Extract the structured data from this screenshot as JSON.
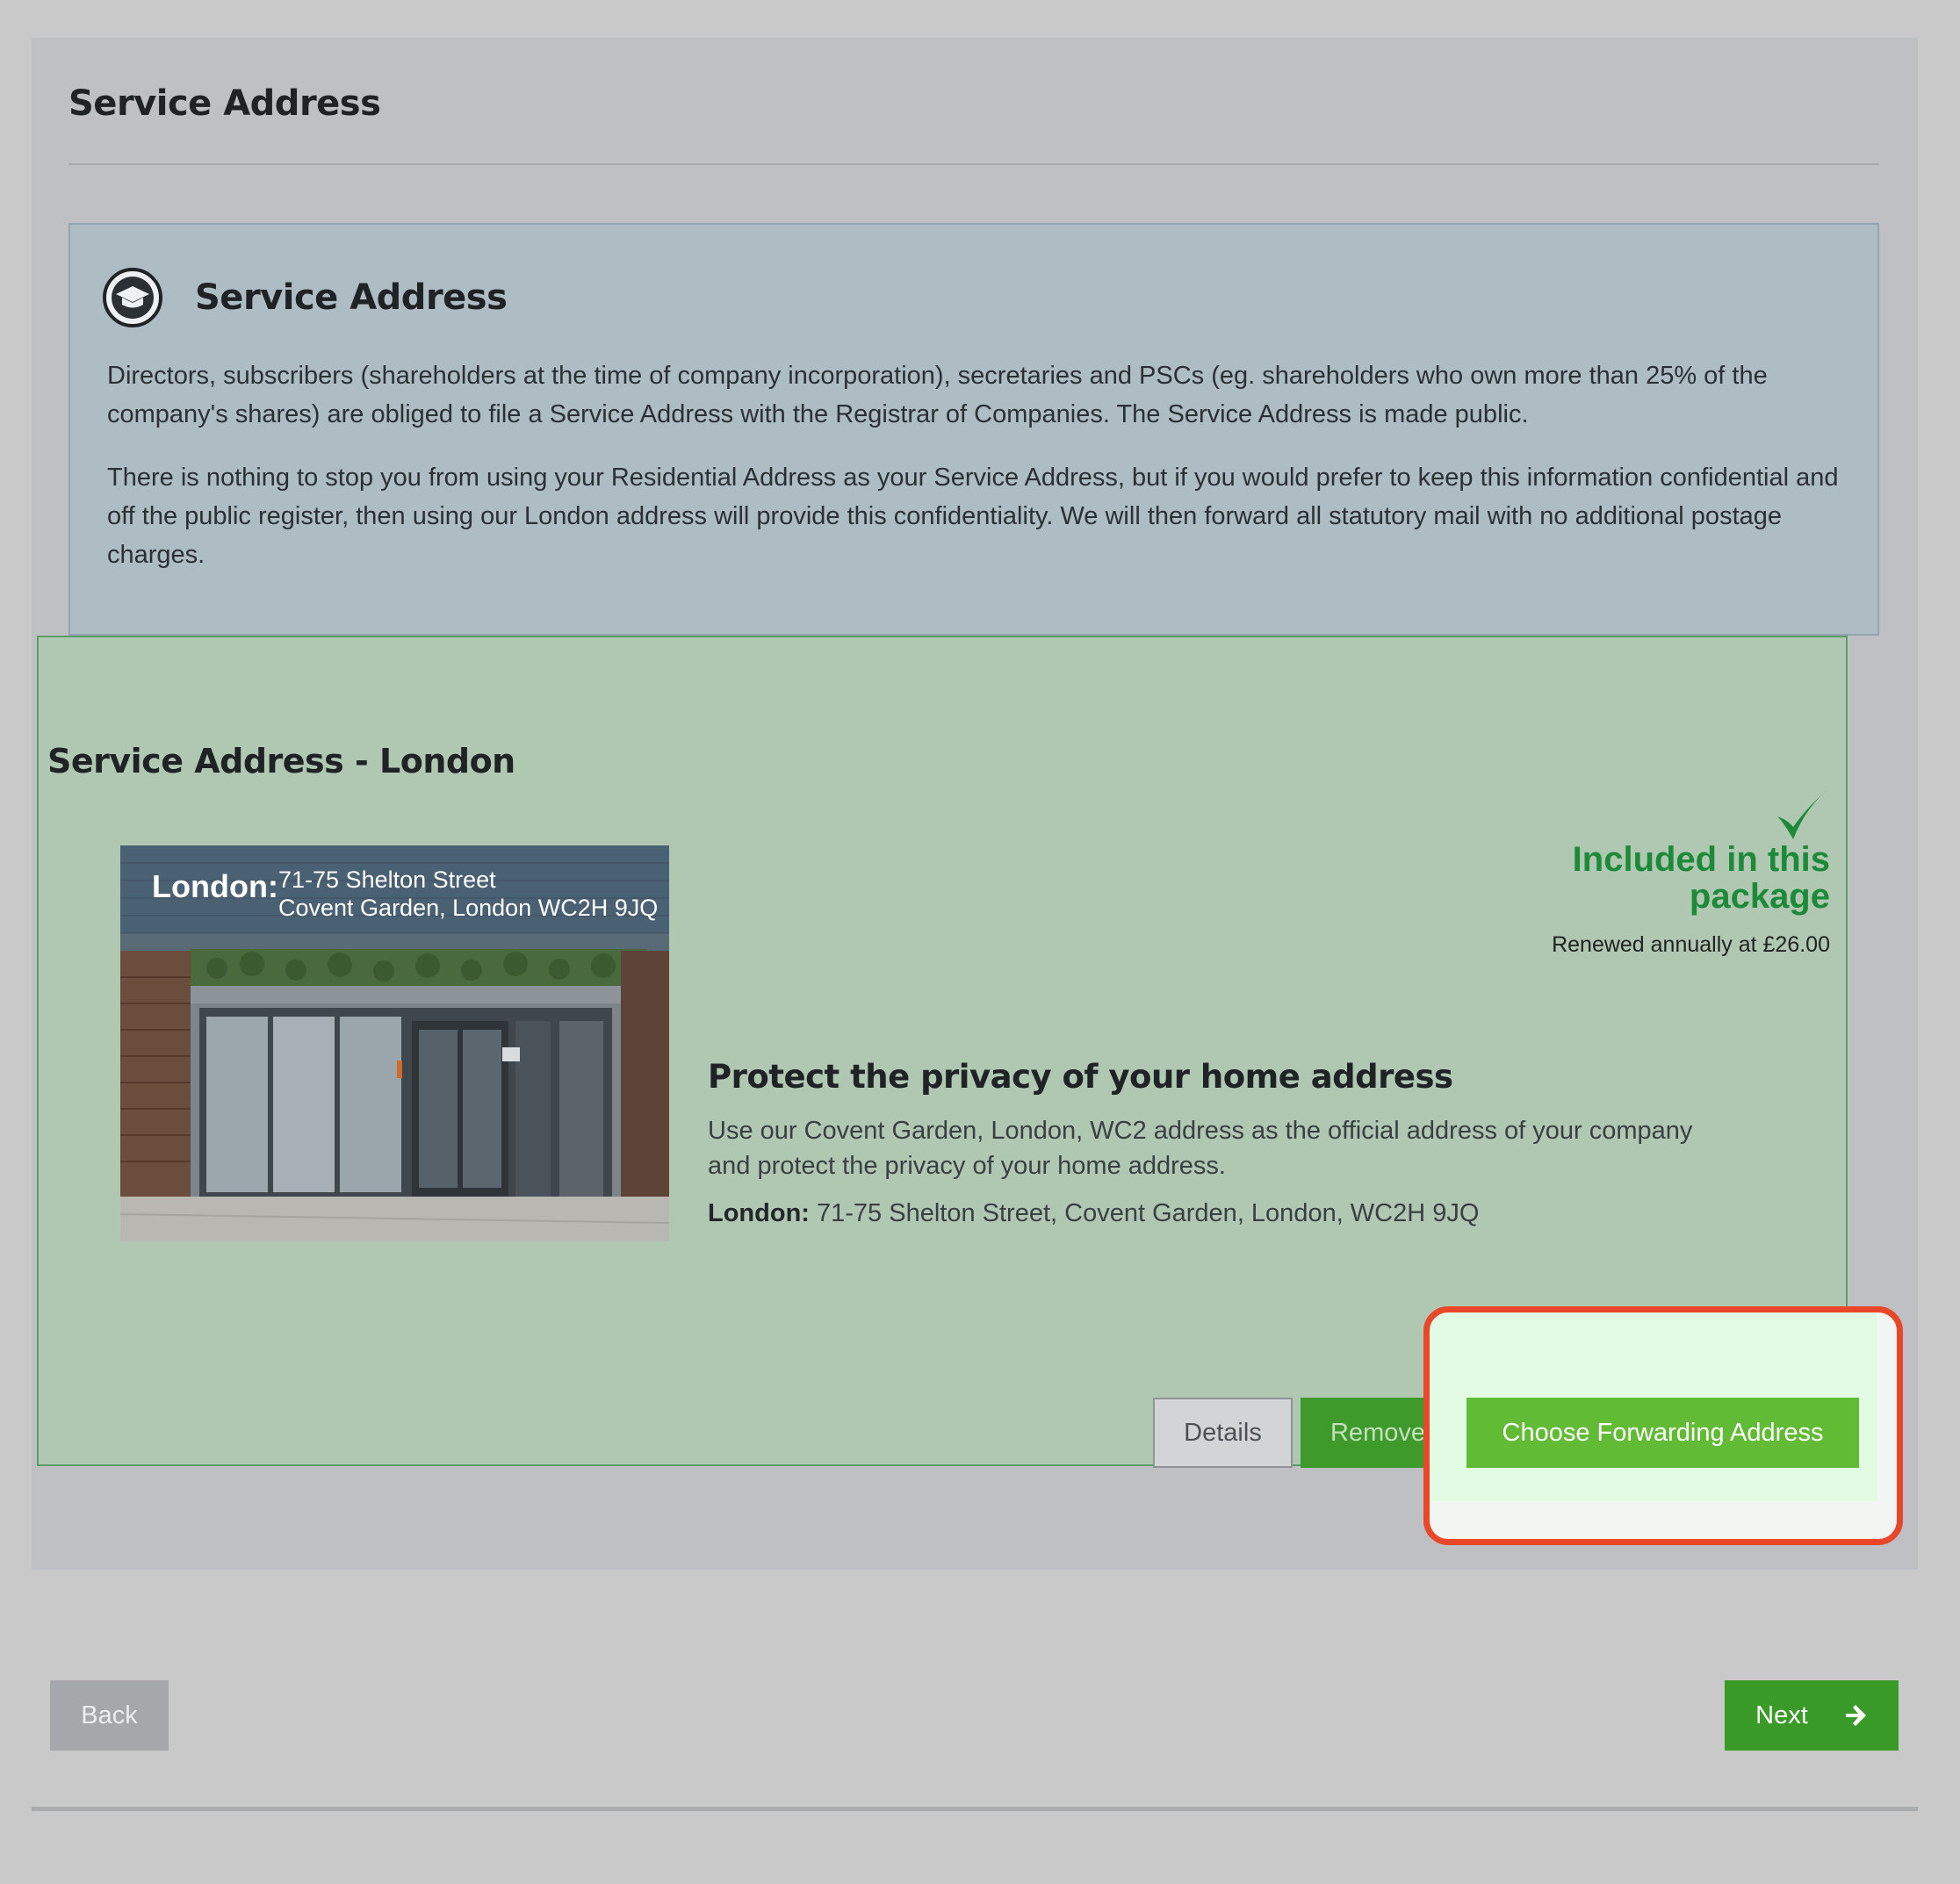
{
  "page": {
    "title": "Service Address"
  },
  "info_box": {
    "icon": "graduation-cap-icon",
    "title": "Service Address",
    "paragraphs": [
      "Directors, subscribers (shareholders at the time of company incorporation), secretaries and PSCs (eg. shareholders who own more than 25% of the company's shares) are obliged to file a Service Address with the Registrar of Companies. The Service Address is made public.",
      "There is nothing to stop you from using your Residential Address as your Service Address, but if you would prefer to keep this information confidential and off the public register, then using our London address will provide this confidentiality. We will then forward all statutory mail with no additional postage charges."
    ]
  },
  "service": {
    "title": "Service Address - London",
    "photo_caption": {
      "city": "London:",
      "line1": "71-75 Shelton Street",
      "line2": "Covent Garden, London WC2H 9JQ"
    },
    "included_icon": "checkmark-icon",
    "included_label": "Included in this package",
    "renewal": "Renewed annually at £26.00",
    "headline": "Protect the privacy of your home address",
    "description": "Use our Covent Garden, London, WC2 address as the official address of your company and protect the privacy of your home address.",
    "address_label": "London:",
    "address_value": "71-75 Shelton Street, Covent Garden, London, WC2H 9JQ",
    "buttons": {
      "details": "Details",
      "remove": "Remove",
      "forward": "Choose Forwarding Address"
    }
  },
  "nav": {
    "back": "Back",
    "next": "Next",
    "next_icon": "arrow-right-icon"
  },
  "colors": {
    "accent_green": "#62bb34",
    "included_green": "#1d8a3a",
    "highlight_red": "#e8472a"
  }
}
